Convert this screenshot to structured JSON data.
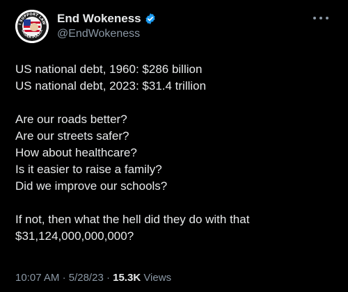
{
  "author": {
    "display_name": "End Wokeness",
    "handle": "@EndWokeness",
    "verified": true,
    "avatar_badge_text_top": "I SUPPORT LAW",
    "avatar_badge_text_bottom": "ORDER POLICE",
    "verified_color": "#1d9bf0"
  },
  "tweet": {
    "lines": [
      "US national debt, 1960: $286 billion",
      "US national debt, 2023: $31.4 trillion",
      "",
      "Are our roads better?",
      "Are our streets safer?",
      "How about healthcare?",
      "Is it easier to raise a family?",
      "Did we improve our schools?",
      "",
      "If not, then what the hell did they do with that",
      "$31,124,000,000,000?"
    ]
  },
  "meta": {
    "time": "10:07 AM",
    "separator": "·",
    "date": "5/28/23",
    "views_count": "15.3K",
    "views_label": "Views"
  },
  "icons": {
    "more": "more-options-icon",
    "verified": "verified-badge-icon"
  }
}
